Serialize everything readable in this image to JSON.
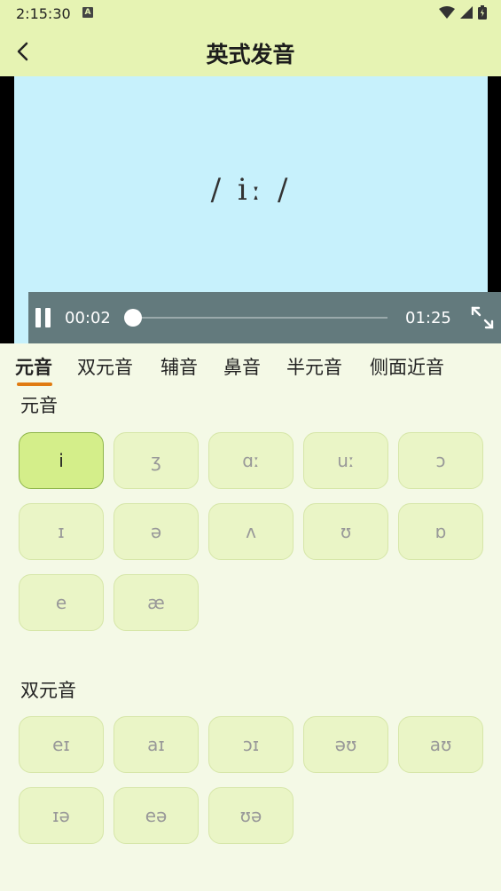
{
  "status": {
    "time": "2:15:30",
    "notif_icon": "A"
  },
  "header": {
    "title": "英式发音",
    "back_icon": "back-arrow-icon"
  },
  "video": {
    "display_text": "/ iː /",
    "current_time": "00:02",
    "total_time": "01:25"
  },
  "tabs": [
    {
      "label": "元音",
      "active": true
    },
    {
      "label": "双元音",
      "active": false
    },
    {
      "label": "辅音",
      "active": false
    },
    {
      "label": "鼻音",
      "active": false
    },
    {
      "label": "半元音",
      "active": false
    },
    {
      "label": "侧面近音",
      "active": false
    }
  ],
  "sections": [
    {
      "title": "元音",
      "items": [
        "i",
        "ʒ",
        "ɑː",
        "uː",
        "ɔ",
        "ɪ",
        "ə",
        "ʌ",
        "ʊ",
        "ɒ",
        "e",
        "æ"
      ],
      "selected_index": 0
    },
    {
      "title": "双元音",
      "items": [
        "eɪ",
        "aɪ",
        "ɔɪ",
        "əʊ",
        "aʊ",
        "ɪə",
        "eə",
        "ʊə"
      ],
      "selected_index": -1
    }
  ],
  "colors": {
    "header_bg": "#e6f3b3",
    "page_bg": "#f4f9e6",
    "button_bg": "#eaf5c6",
    "button_active_bg": "#d4ee8a",
    "tab_indicator": "#e07b12",
    "video_bg": "#c7f1fc",
    "controls_bg": "#637a7d"
  }
}
